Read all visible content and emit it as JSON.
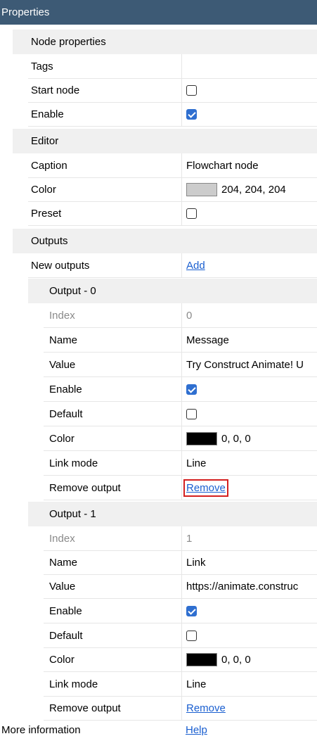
{
  "panel": {
    "title": "Properties"
  },
  "node_properties": {
    "header": "Node properties",
    "tags_label": "Tags",
    "tags_value": "",
    "start_node_label": "Start node",
    "start_node_checked": false,
    "enable_label": "Enable",
    "enable_checked": true
  },
  "editor": {
    "header": "Editor",
    "caption_label": "Caption",
    "caption_value": "Flowchart node",
    "color_label": "Color",
    "color_value": "204, 204, 204",
    "color_hex": "#cccccc",
    "preset_label": "Preset",
    "preset_checked": false
  },
  "outputs": {
    "header": "Outputs",
    "new_outputs_label": "New outputs",
    "add_link": "Add",
    "items": [
      {
        "header": "Output - 0",
        "index_label": "Index",
        "index_value": "0",
        "name_label": "Name",
        "name_value": "Message",
        "value_label": "Value",
        "value_value": "Try Construct Animate! U",
        "enable_label": "Enable",
        "enable_checked": true,
        "default_label": "Default",
        "default_checked": false,
        "color_label": "Color",
        "color_value": "0, 0, 0",
        "color_hex": "#000000",
        "link_mode_label": "Link mode",
        "link_mode_value": "Line",
        "remove_label": "Remove output",
        "remove_link": "Remove"
      },
      {
        "header": "Output - 1",
        "index_label": "Index",
        "index_value": "1",
        "name_label": "Name",
        "name_value": "Link",
        "value_label": "Value",
        "value_value": "https://animate.construc",
        "enable_label": "Enable",
        "enable_checked": true,
        "default_label": "Default",
        "default_checked": false,
        "color_label": "Color",
        "color_value": "0, 0, 0",
        "color_hex": "#000000",
        "link_mode_label": "Link mode",
        "link_mode_value": "Line",
        "remove_label": "Remove output",
        "remove_link": "Remove"
      }
    ]
  },
  "more_info": {
    "label": "More information",
    "help_link": "Help"
  },
  "colors": {
    "title_bar": "#3d5a75",
    "highlight": "#d42020",
    "link": "#1a5fd0"
  }
}
